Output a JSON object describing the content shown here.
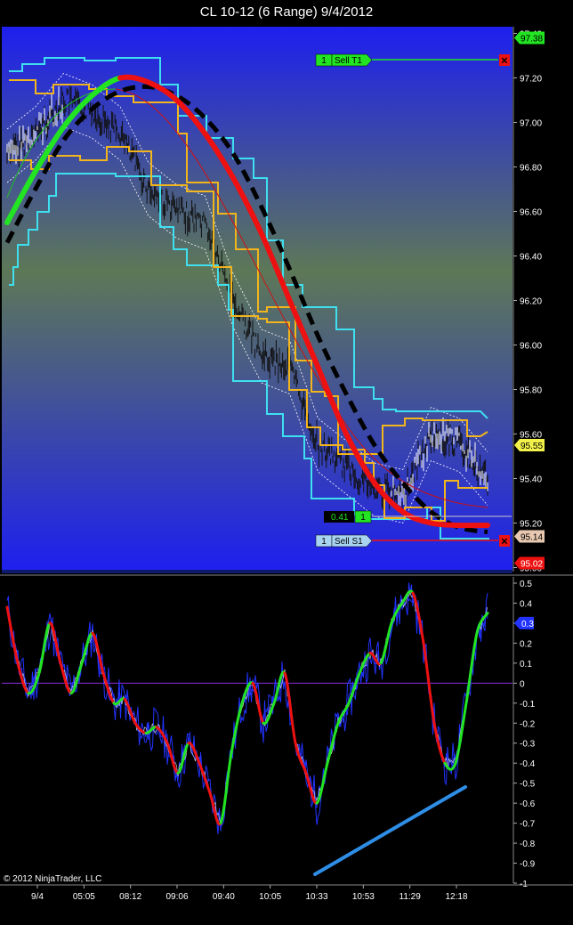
{
  "window": {
    "title": "CL 10-12 (6 Range)  9/4/2012"
  },
  "copyright": "© 2012 NinjaTrader, LLC",
  "colors": {
    "background_top": "#1E1FEF",
    "background_mid": "#5D7857",
    "channel_outer": "#3EE0F0",
    "channel_inner": "#F2B51C",
    "trend_up": "#22E422",
    "trend_down": "#EE1111",
    "trend_dashed": "#000000",
    "oscillator": "#2233FF",
    "trendline": "#2E8EE6"
  },
  "orders": {
    "sell_t1": {
      "qty": "1",
      "label": "Sell T1",
      "price": "97.38"
    },
    "sell_s1": {
      "qty": "1",
      "label": "Sell S1",
      "price": "95.02"
    },
    "position": {
      "pnl": "0.41",
      "qty": "1"
    }
  },
  "chart_data": [
    {
      "type": "line",
      "title": "CL 10-12 (6 Range)  9/4/2012",
      "x_tick_labels": [
        "9/4",
        "05:05",
        "08:12",
        "09:06",
        "09:40",
        "10:05",
        "10:33",
        "10:53",
        "11:29",
        "12:18"
      ],
      "y_ticks": [
        "97.40",
        "97.20",
        "97.00",
        "96.80",
        "96.60",
        "96.40",
        "96.20",
        "96.00",
        "95.80",
        "95.60",
        "95.40",
        "95.20",
        "95.00"
      ],
      "ylim": [
        94.99,
        97.43
      ],
      "price_markers": [
        {
          "label": "97.38",
          "value": 97.38,
          "color": "#22E422"
        },
        {
          "label": "95.55",
          "value": 95.55,
          "color": "#F2F24A"
        },
        {
          "label": "95.14",
          "value": 95.14,
          "color": "#E8C8B0"
        },
        {
          "label": "95.02",
          "value": 95.02,
          "color": "#EE1111"
        }
      ],
      "series": [
        {
          "values": [
            96.55,
            96.78,
            96.98,
            97.12,
            97.2,
            97.18,
            97.1,
            96.95,
            96.75,
            96.5,
            96.2,
            95.9,
            95.6,
            95.38,
            95.25,
            95.2,
            95.19,
            95.19
          ]
        },
        {
          "values": [
            96.46,
            96.7,
            96.92,
            97.06,
            97.14,
            97.16,
            97.12,
            97.02,
            96.86,
            96.62,
            96.34,
            96.04,
            95.78,
            95.55,
            95.38,
            95.25,
            95.18,
            95.16
          ]
        },
        {
          "values": [
            96.85,
            96.95,
            97.1,
            97.05,
            96.95,
            96.7,
            96.6,
            96.55,
            96.2,
            95.95,
            95.9,
            95.55,
            95.45,
            95.35,
            95.32,
            95.6,
            95.55,
            95.4
          ]
        }
      ]
    },
    {
      "type": "line",
      "y_ticks": [
        "0.5",
        "0.4",
        "0.3",
        "0.2",
        "0.1",
        "0",
        "-0.1",
        "-0.2",
        "-0.3",
        "-0.4",
        "-0.5",
        "-0.6",
        "-0.7",
        "-0.8",
        "-0.9",
        "-1"
      ],
      "ylim": [
        -1,
        0.5
      ],
      "current_value": "0.3",
      "series": [
        {
          "values": [
            0.38,
            0.1,
            -0.05,
            0.05,
            0.3,
            0.1,
            -0.05,
            0.1,
            0.25,
            0.05,
            -0.1,
            -0.08,
            -0.2,
            -0.25,
            -0.22,
            -0.3,
            -0.45,
            -0.3,
            -0.4,
            -0.55,
            -0.7,
            -0.35,
            -0.1,
            0.0,
            -0.2,
            -0.1,
            0.05,
            -0.3,
            -0.45,
            -0.6,
            -0.4,
            -0.2,
            -0.1,
            0.05,
            0.15,
            0.1,
            0.3,
            0.4,
            0.45,
            0.2,
            -0.2,
            -0.4,
            -0.4,
            -0.1,
            0.25,
            0.35
          ]
        }
      ]
    }
  ]
}
